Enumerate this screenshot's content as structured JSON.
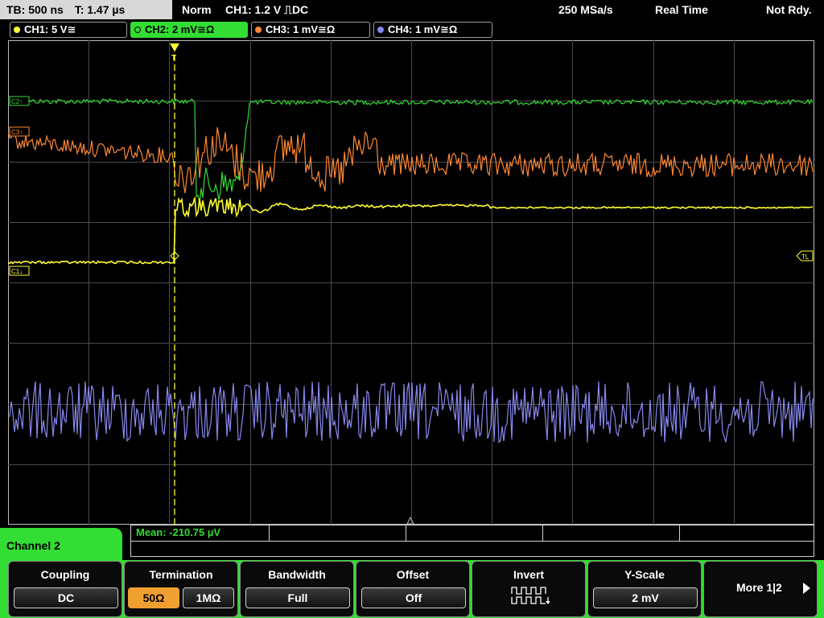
{
  "status": {
    "timebase": "TB: 500 ns",
    "trigger_time": "T: 1.47 µs",
    "trigger_mode": "Norm",
    "trigger_source": "CH1: 1.2 V ⎍DC",
    "sample_rate": "250 MSa/s",
    "acq_mode": "Real Time",
    "acq_state": "Not Rdy."
  },
  "channels": [
    {
      "label": "CH1: 5 V≅",
      "color": "#ffff33"
    },
    {
      "label": "CH2: 2 mV≅Ω",
      "color": "#33dd33"
    },
    {
      "label": "CH3: 1 mV≅Ω",
      "color": "#ff8833"
    },
    {
      "label": "CH4: 1 mV≅Ω",
      "color": "#8888ee"
    }
  ],
  "grid_markers": {
    "ch2": "C2↑",
    "ch3": "C3↑",
    "ch1": "C1↓",
    "trigger_level": "TL"
  },
  "measurement": {
    "text": "Mean: -210.75 µV"
  },
  "menu": {
    "title": "Channel 2",
    "coupling": {
      "title": "Coupling",
      "value": "DC"
    },
    "termination": {
      "title": "Termination",
      "option_50": "50Ω",
      "option_1m": "1MΩ",
      "selected": "50Ω"
    },
    "bandwidth": {
      "title": "Bandwidth",
      "value": "Full"
    },
    "offset": {
      "title": "Offset",
      "value": "Off"
    },
    "invert": {
      "title": "Invert"
    },
    "yscale": {
      "title": "Y-Scale",
      "value": "2 mV"
    },
    "more": {
      "label": "More 1|2"
    }
  }
}
